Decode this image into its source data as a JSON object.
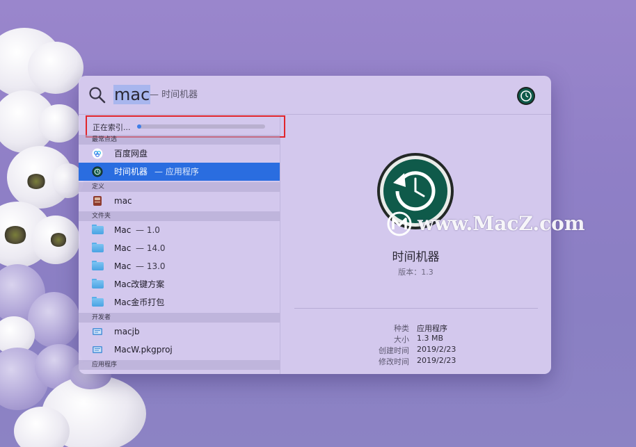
{
  "search": {
    "query": "mac",
    "hint": "— 时间机器"
  },
  "indexing": {
    "label": "正在索引...",
    "progress": 0.03
  },
  "sections": [
    {
      "header": "最常点选",
      "items": [
        {
          "name": "百度网盘",
          "sub": "",
          "icon": "baidu-netdisk-icon"
        },
        {
          "name": "时间机器",
          "sub": "— 应用程序",
          "icon": "time-machine-icon",
          "selected": true
        }
      ]
    },
    {
      "header": "定义",
      "items": [
        {
          "name": "mac",
          "sub": "",
          "icon": "dictionary-icon"
        }
      ]
    },
    {
      "header": "文件夹",
      "items": [
        {
          "name": "Mac",
          "sub": "— 1.0",
          "icon": "folder-icon"
        },
        {
          "name": "Mac",
          "sub": "— 14.0",
          "icon": "folder-icon"
        },
        {
          "name": "Mac",
          "sub": "— 13.0",
          "icon": "folder-icon"
        },
        {
          "name": "Mac改键方案",
          "sub": "",
          "icon": "folder-icon"
        },
        {
          "name": "Mac金币打包",
          "sub": "",
          "icon": "folder-icon"
        }
      ]
    },
    {
      "header": "开发者",
      "items": [
        {
          "name": "macjb",
          "sub": "",
          "icon": "xcode-project-icon"
        },
        {
          "name": "MacW.pkgproj",
          "sub": "",
          "icon": "package-project-icon"
        }
      ]
    },
    {
      "header": "应用程序",
      "items": []
    }
  ],
  "preview": {
    "name": "时间机器",
    "version": "版本：1.3",
    "meta": [
      {
        "key": "种类",
        "value": "应用程序"
      },
      {
        "key": "大小",
        "value": "1.3 MB"
      },
      {
        "key": "创建时间",
        "value": "2019/2/23"
      },
      {
        "key": "修改时间",
        "value": "2019/2/23"
      }
    ]
  },
  "watermark": {
    "text": "www.MacZ.com"
  },
  "colors": {
    "selection": "#2a6de0",
    "progress": "#3f7ee8",
    "highlight_box": "#e1252b",
    "time_machine": "#0f5a4a"
  }
}
